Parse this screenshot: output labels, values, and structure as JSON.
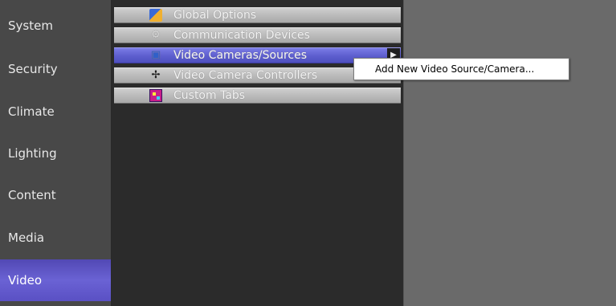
{
  "sidebar": {
    "items": [
      {
        "label": "System"
      },
      {
        "label": "Security"
      },
      {
        "label": "Climate"
      },
      {
        "label": "Lighting"
      },
      {
        "label": "Content"
      },
      {
        "label": "Media"
      },
      {
        "label": "Video",
        "selected": true
      }
    ]
  },
  "menu": {
    "items": [
      {
        "label": "Global Options",
        "icon": "global-options-icon"
      },
      {
        "label": "Communication Devices",
        "icon": "communication-devices-icon"
      },
      {
        "label": "Video Cameras/Sources",
        "icon": "video-camera-icon",
        "highlighted": true,
        "has_submenu": true
      },
      {
        "label": "Video Camera Controllers",
        "icon": "camera-controller-icon"
      },
      {
        "label": "Custom Tabs",
        "icon": "custom-tabs-icon"
      }
    ],
    "submenu_arrow": "▶"
  },
  "context_menu": {
    "items": [
      {
        "label": "Add New Video Source/Camera..."
      }
    ]
  },
  "colors": {
    "sidebar_bg": "#484848",
    "selected_bg": "#5a50c4",
    "menu_panel_bg": "#2b2b2b",
    "menu_item_bg": "#bdbdbd",
    "menu_highlight_bg": "#5f60d0",
    "content_bg": "#6a6a6a"
  }
}
